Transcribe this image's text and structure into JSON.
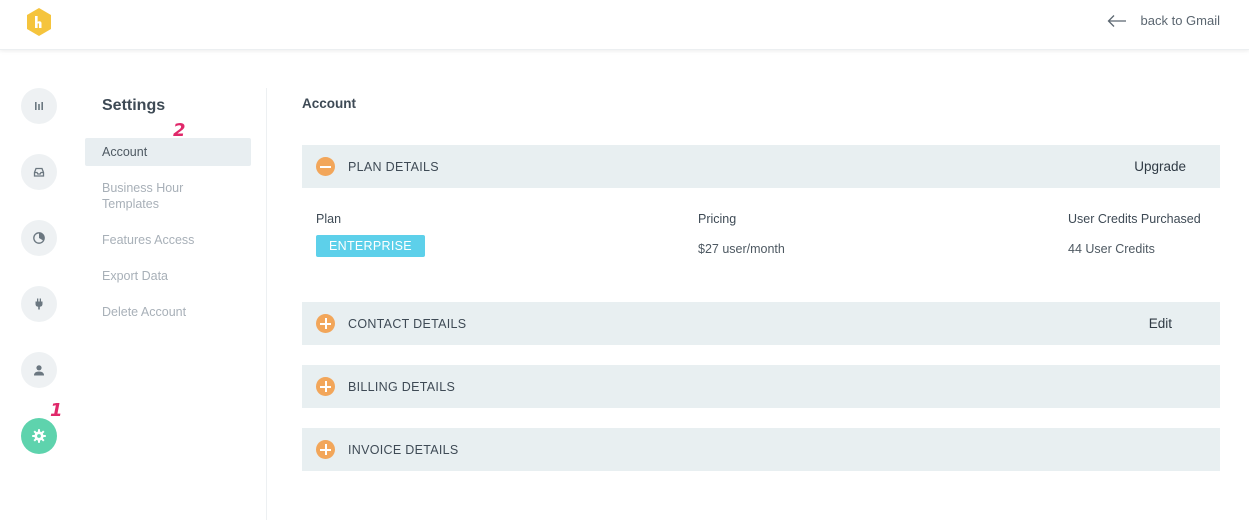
{
  "header": {
    "logo": "honeybee-logo",
    "back_label": "back to Gmail"
  },
  "rail": [
    {
      "icon": "bar-chart-icon"
    },
    {
      "icon": "inbox-tray-icon"
    },
    {
      "icon": "pie-chart-icon"
    },
    {
      "icon": "plug-icon"
    },
    {
      "icon": "user-icon"
    },
    {
      "icon": "gear-icon",
      "active": true
    }
  ],
  "annotations": [
    "1",
    "2"
  ],
  "settings_menu": {
    "title": "Settings",
    "items": [
      {
        "label": "Account",
        "active": true
      },
      {
        "label": "Business Hour Templates"
      },
      {
        "label": "Features Access"
      },
      {
        "label": "Export Data"
      },
      {
        "label": "Delete Account"
      }
    ]
  },
  "main": {
    "title": "Account",
    "sections": [
      {
        "title": "PLAN DETAILS",
        "action": "Upgrade",
        "expanded": true
      },
      {
        "title": "CONTACT DETAILS",
        "action": "Edit",
        "expanded": false
      },
      {
        "title": "BILLING DETAILS",
        "action": "",
        "expanded": false
      },
      {
        "title": "INVOICE DETAILS",
        "action": "",
        "expanded": false
      }
    ],
    "plan": {
      "plan_label": "Plan",
      "plan_value": "ENTERPRISE",
      "pricing_label": "Pricing",
      "pricing_value": "$27 user/month",
      "credits_label": "User Credits Purchased",
      "credits_value": "44 User Credits"
    }
  },
  "colors": {
    "accent_green": "#5ed3ad",
    "toggle_orange": "#f2a65a",
    "badge_blue": "#5dd0ea",
    "section_bg": "#e8eff1",
    "annotation_pink": "#e0286a"
  }
}
